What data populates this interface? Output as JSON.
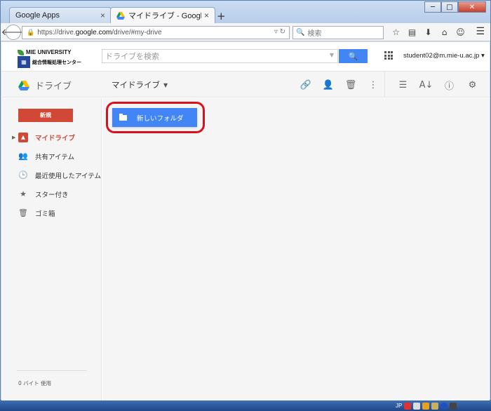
{
  "browser": {
    "tabs": [
      {
        "label": "Google Apps",
        "close": "×"
      },
      {
        "label": "マイドライブ - Google ...",
        "close": "×"
      }
    ],
    "new_tab": "+",
    "window_controls": {
      "min": "─",
      "max": "□",
      "close": "✕"
    },
    "url": {
      "scheme": "https://drive.",
      "host": "google.com",
      "path": "/drive/#my-drive"
    },
    "search_placeholder": "検索"
  },
  "header": {
    "logo_line1": "MIE UNIVERSITY",
    "logo_line2": "総合情報処理センター",
    "search_placeholder": "ドライブを検索",
    "account": "student02@m.mie-u.ac.jp"
  },
  "toolbar": {
    "brand": "ドライブ",
    "location": "マイドライブ"
  },
  "sidebar": {
    "new_button": "新規",
    "items": [
      {
        "label": "マイドライブ",
        "icon": "drive-icon",
        "active": true
      },
      {
        "label": "共有アイテム",
        "icon": "people-icon",
        "active": false
      },
      {
        "label": "最近使用したアイテム",
        "icon": "clock-icon",
        "active": false
      },
      {
        "label": "スター付き",
        "icon": "star-icon",
        "active": false
      },
      {
        "label": "ゴミ箱",
        "icon": "trash-icon",
        "active": false
      }
    ],
    "storage": "0 バイト 使用"
  },
  "content": {
    "folders": [
      {
        "name": "新しいフォルダ"
      }
    ]
  },
  "taskbar": {
    "lang": "JP"
  },
  "colors": {
    "accent_blue": "#4285f4",
    "new_red": "#d14836",
    "highlight_red": "#d7121c"
  }
}
